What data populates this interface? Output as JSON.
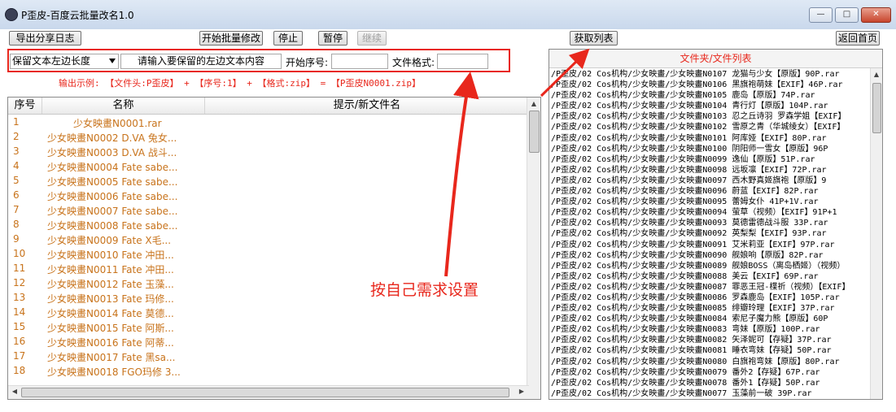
{
  "window": {
    "title": "P歪皮-百度云批量改名1.0"
  },
  "toolbar": {
    "export_log": "导出分享日志",
    "start_batch": "开始批量修改",
    "stop": "停止",
    "pause": "暂停",
    "resume": "继续",
    "get_list": "获取列表",
    "back_home": "返回首页"
  },
  "options": {
    "mode_select": "保留文本左边长度",
    "keep_text_placeholder": "请输入要保留的左边文本内容",
    "start_index_label": "开始序号:",
    "start_index_value": "",
    "file_format_label": "文件格式:",
    "file_format_value": "",
    "example": "输出示例: 【文件头:P歪皮】 + 【序号:1】 + 【格式:zip】 = 【P歪皮N0001.zip】"
  },
  "table": {
    "columns": [
      "序号",
      "名称",
      "提示/新文件名"
    ],
    "rows": [
      {
        "index": "1",
        "name": "少女映畫N0001.rar"
      },
      {
        "index": "2",
        "name": "少女映畫N0002 D.VA 兔女..."
      },
      {
        "index": "3",
        "name": "少女映畫N0003 D.VA 战斗..."
      },
      {
        "index": "4",
        "name": "少女映畫N0004 Fate sabe..."
      },
      {
        "index": "5",
        "name": "少女映畫N0005 Fate sabe..."
      },
      {
        "index": "6",
        "name": "少女映畫N0006 Fate sabe..."
      },
      {
        "index": "7",
        "name": "少女映畫N0007 Fate sabe..."
      },
      {
        "index": "8",
        "name": "少女映畫N0008 Fate sabe..."
      },
      {
        "index": "9",
        "name": "少女映畫N0009 Fate X毛..."
      },
      {
        "index": "10",
        "name": "少女映畫N0010 Fate 冲田..."
      },
      {
        "index": "11",
        "name": "少女映畫N0011 Fate 冲田..."
      },
      {
        "index": "12",
        "name": "少女映畫N0012 Fate 玉藻..."
      },
      {
        "index": "13",
        "name": "少女映畫N0013 Fate 玛修..."
      },
      {
        "index": "14",
        "name": "少女映畫N0014 Fate 莫德..."
      },
      {
        "index": "15",
        "name": "少女映畫N0015 Fate 阿斯..."
      },
      {
        "index": "16",
        "name": "少女映畫N0016 Fate 阿蒂..."
      },
      {
        "index": "17",
        "name": "少女映畫N0017 Fate 黑sa..."
      },
      {
        "index": "18",
        "name": "少女映畫N0018 FGO玛修 3..."
      }
    ]
  },
  "file_list": {
    "title": "文件夹/文件列表",
    "items": [
      "/P歪皮/02 Cos机构/少女映畫/少女映畫N0107 龙猫与少女【原版】90P.rar",
      "/P歪皮/02 Cos机构/少女映畫/少女映畫N0106 黑旗袍萌妹【EXIF】46P.rar",
      "/P歪皮/02 Cos机构/少女映畫/少女映畫N0105 鹿岛【原版】74P.rar",
      "/P歪皮/02 Cos机构/少女映畫/少女映畫N0104 青行灯【原版】104P.rar",
      "/P歪皮/02 Cos机构/少女映畫/少女映畫N0103 忍之丘诗羽 罗森学姐【EXIF】",
      "/P歪皮/02 Cos机构/少女映畫/少女映畫N0102 雪原之青（华城绫女）【EXIF】",
      "/P歪皮/02 Cos机构/少女映畫/少女映畫N0101 阿库娅【EXIF】80P.rar",
      "/P歪皮/02 Cos机构/少女映畫/少女映畫N0100 阴阳师一雪女【原版】96P",
      "/P歪皮/02 Cos机构/少女映畫/少女映畫N0099 逸仙【原版】51P.rar",
      "/P歪皮/02 Cos机构/少女映畫/少女映畫N0098 远坂凛【EXIF】72P.rar",
      "/P歪皮/02 Cos机构/少女映畫/少女映畫N0097 西木野真姬旗袍【原版】9",
      "/P歪皮/02 Cos机构/少女映畫/少女映畫N0096 蔚蓝【EXIF】82P.rar",
      "/P歪皮/02 Cos机构/少女映畫/少女映畫N0095 蕾姆女仆 41P+1V.rar",
      "/P歪皮/02 Cos机构/少女映畫/少女映畫N0094 萤草（视频）【EXIF】91P+1",
      "/P歪皮/02 Cos机构/少女映畫/少女映畫N0093 莫德雷德战斗服 33P.rar",
      "/P歪皮/02 Cos机构/少女映畫/少女映畫N0092 英梨梨【EXIF】93P.rar",
      "/P歪皮/02 Cos机构/少女映畫/少女映畫N0091 艾米莉亚【EXIF】97P.rar",
      "/P歪皮/02 Cos机构/少女映畫/少女映畫N0090 舰娘响【原版】82P.rar",
      "/P歪皮/02 Cos机构/少女映畫/少女映畫N0089 舰娘BOSS（离岛栖姬）（视频）",
      "/P歪皮/02 Cos机构/少女映畫/少女映畫N0088 美云【EXIF】69P.rar",
      "/P歪皮/02 Cos机构/少女映畫/少女映畫N0087 罪恶王冠-楪祈（视频）【EXIF】",
      "/P歪皮/02 Cos机构/少女映畫/少女映畫N0086 罗森鹿岛【EXIF】105P.rar",
      "/P歪皮/02 Cos机构/少女映畫/少女映畫N0085 绯瓣玲理【EXIF】37P.rar",
      "/P歪皮/02 Cos机构/少女映畫/少女映畫N0084 索尼子魔力熊【原版】60P",
      "/P歪皮/02 Cos机构/少女映畫/少女映畫N0083 弯妹【原版】100P.rar",
      "/P歪皮/02 Cos机构/少女映畫/少女映畫N0082 矢泽妮可【存疑】37P.rar",
      "/P歪皮/02 Cos机构/少女映畫/少女映畫N0081 睡衣弯妹【存疑】50P.rar",
      "/P歪皮/02 Cos机构/少女映畫/少女映畫N0080 白旗袍弯妹【原版】80P.rar",
      "/P歪皮/02 Cos机构/少女映畫/少女映畫N0079 番外2【存疑】67P.rar",
      "/P歪皮/02 Cos机构/少女映畫/少女映畫N0078 番外1【存疑】50P.rar",
      "/P歪皮/02 Cos机构/少女映畫/少女映畫N0077 玉藻前一破 39P.rar"
    ]
  },
  "annotation": {
    "text": "按自己需求设置"
  },
  "colors": {
    "accent_red": "#e8271c",
    "name_orange": "#c8731b"
  }
}
